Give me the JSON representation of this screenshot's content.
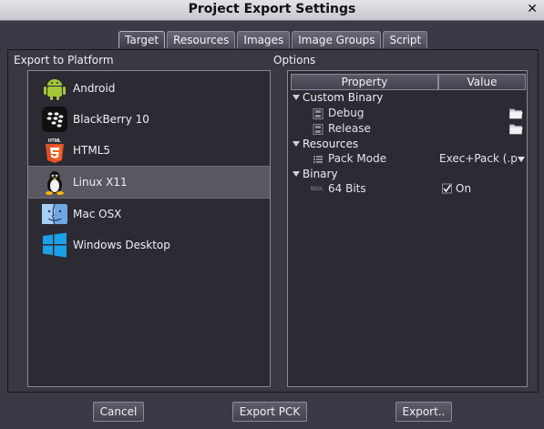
{
  "window": {
    "title": "Project Export Settings",
    "close_glyph": "✕"
  },
  "tabs": [
    {
      "label": "Target",
      "active": true
    },
    {
      "label": "Resources"
    },
    {
      "label": "Images"
    },
    {
      "label": "Image Groups"
    },
    {
      "label": "Script"
    }
  ],
  "export_section": {
    "label": "Export to Platform"
  },
  "platforms": [
    {
      "label": "Android",
      "icon": "android-icon"
    },
    {
      "label": "BlackBerry 10",
      "icon": "blackberry-icon"
    },
    {
      "label": "HTML5",
      "icon": "html5-icon"
    },
    {
      "label": "Linux X11",
      "icon": "linux-icon",
      "selected": true
    },
    {
      "label": "Mac OSX",
      "icon": "mac-icon"
    },
    {
      "label": "Windows Desktop",
      "icon": "windows-icon"
    }
  ],
  "options_section": {
    "label": "Options"
  },
  "options_table": {
    "headers": {
      "property": "Property",
      "value": "Value"
    },
    "groups": [
      {
        "name": "Custom Binary",
        "items": [
          {
            "label": "Debug",
            "value": "",
            "icon": "file-icon",
            "action_icon": "folder-icon"
          },
          {
            "label": "Release",
            "value": "",
            "icon": "file-icon",
            "action_icon": "folder-icon"
          }
        ]
      },
      {
        "name": "Resources",
        "items": [
          {
            "label": "Pack Mode",
            "value": "Exec+Pack (.p",
            "icon": "list-icon",
            "action_icon": "dropdown-arrow-icon"
          }
        ]
      },
      {
        "name": "Binary",
        "items": [
          {
            "label": "64 Bits",
            "value": "On",
            "icon": "bool-icon",
            "type_tag": "BOOL",
            "checked": true
          }
        ]
      }
    ]
  },
  "buttons": {
    "cancel": "Cancel",
    "export_pck": "Export PCK",
    "export": "Export.."
  }
}
